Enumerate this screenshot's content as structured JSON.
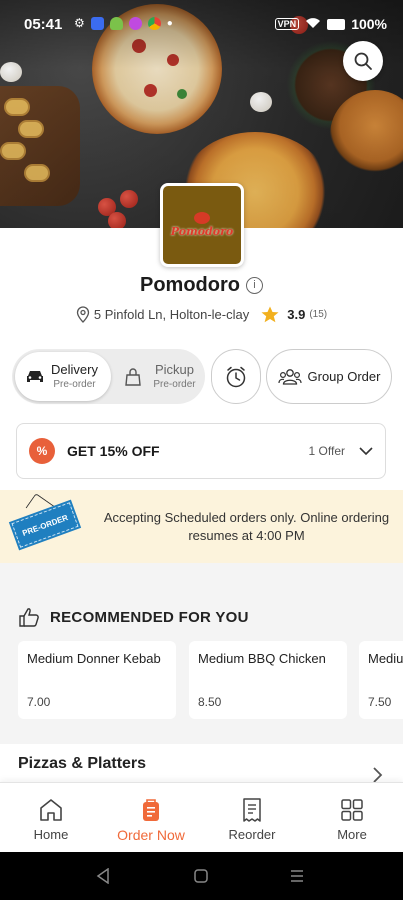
{
  "status_bar": {
    "time": "05:41",
    "vpn": "VPN",
    "battery": "100%"
  },
  "restaurant": {
    "logo_text": "Pomodoro",
    "name": "Pomodoro",
    "address": "5 Pinfold Ln, Holton-le-clay",
    "rating": "3.9",
    "rating_count": "(15)"
  },
  "order_type": {
    "delivery_label": "Delivery",
    "delivery_sub": "Pre-order",
    "pickup_label": "Pickup",
    "pickup_sub": "Pre-order",
    "group_order_label": "Group Order"
  },
  "offer": {
    "badge": "%",
    "title": "GET 15% OFF",
    "count": "1 Offer"
  },
  "notice": {
    "tag": "PRE-ORDER",
    "text": "Accepting Scheduled orders only. Online ordering resumes at 4:00 PM"
  },
  "recommended": {
    "title": "RECOMMENDED FOR YOU",
    "items": [
      {
        "name": "Medium Donner Kebab",
        "price": "7.00"
      },
      {
        "name": "Medium BBQ Chicken",
        "price": "8.50"
      },
      {
        "name": "Medium Tomato",
        "price": "7.50"
      }
    ]
  },
  "category": {
    "title": "Pizzas & Platters"
  },
  "bottom_nav": [
    {
      "label": "Home",
      "icon": "home-icon"
    },
    {
      "label": "Order Now",
      "icon": "order-bag-icon"
    },
    {
      "label": "Reorder",
      "icon": "receipt-icon"
    },
    {
      "label": "More",
      "icon": "grid-icon"
    }
  ],
  "colors": {
    "accent": "#f06a3a",
    "notice_bg": "#fcf3dc",
    "star": "#f2b01e",
    "preorder_blue": "#1f7fc0"
  }
}
